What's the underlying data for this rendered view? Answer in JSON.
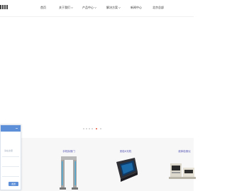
{
  "header": {
    "logo_alt": "logo"
  },
  "nav": [
    {
      "label": "首页"
    },
    {
      "label": "关于我们"
    },
    {
      "label": "产品中心"
    },
    {
      "label": "解决方案"
    },
    {
      "label": "新闻中心"
    },
    {
      "label": "北京总部"
    }
  ],
  "carousel": {
    "dot_count": 6,
    "active_index": 4
  },
  "products": [
    {
      "title": "手机探测门"
    },
    {
      "title": "安检X光机"
    },
    {
      "title": "液体检测仪"
    }
  ],
  "chat": {
    "hint": "请在这里",
    "send_label": "发送"
  },
  "colors": {
    "accent": "#e8573a",
    "chat_blue": "#5c8fd8",
    "product_title": "#4b4bb0"
  }
}
